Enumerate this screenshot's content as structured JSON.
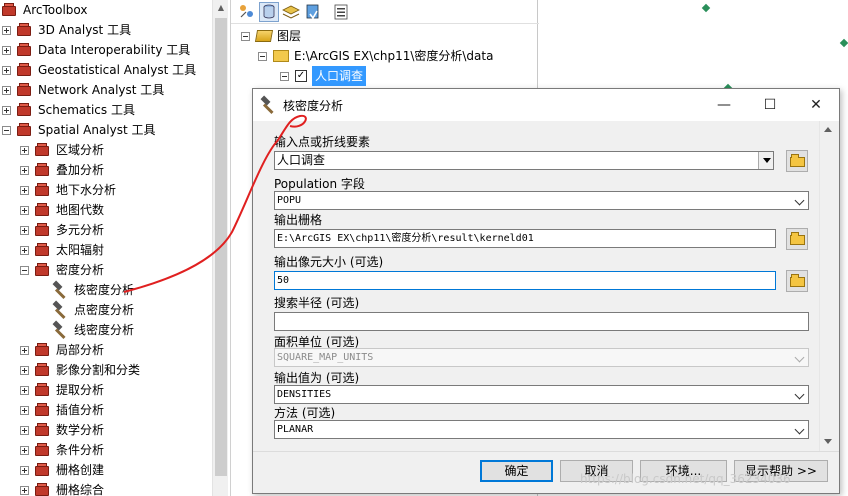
{
  "toolbox": {
    "root": "ArcToolbox",
    "toolsets": [
      {
        "label": "3D Analyst 工具",
        "expanded": false
      },
      {
        "label": "Data Interoperability 工具",
        "expanded": false
      },
      {
        "label": "Geostatistical Analyst 工具",
        "expanded": false
      },
      {
        "label": "Network Analyst 工具",
        "expanded": false
      },
      {
        "label": "Schematics 工具",
        "expanded": false
      },
      {
        "label": "Spatial Analyst 工具",
        "expanded": true
      }
    ],
    "spatial_children": [
      {
        "label": "区域分析",
        "expanded": false
      },
      {
        "label": "叠加分析",
        "expanded": false
      },
      {
        "label": "地下水分析",
        "expanded": false
      },
      {
        "label": "地图代数",
        "expanded": false
      },
      {
        "label": "多元分析",
        "expanded": false
      },
      {
        "label": "太阳辐射",
        "expanded": false
      },
      {
        "label": "密度分析",
        "expanded": true
      },
      {
        "label": "局部分析",
        "expanded": false
      },
      {
        "label": "影像分割和分类",
        "expanded": false
      },
      {
        "label": "提取分析",
        "expanded": false
      },
      {
        "label": "插值分析",
        "expanded": false
      },
      {
        "label": "数学分析",
        "expanded": false
      },
      {
        "label": "条件分析",
        "expanded": false
      },
      {
        "label": "栅格创建",
        "expanded": false
      },
      {
        "label": "栅格综合",
        "expanded": false
      }
    ],
    "density_tools": [
      {
        "label": "核密度分析"
      },
      {
        "label": "点密度分析"
      },
      {
        "label": "线密度分析"
      }
    ]
  },
  "toc": {
    "layers_label": "图层",
    "folder_path": "E:\\ArcGIS EX\\chp11\\密度分析\\data",
    "layer_name": "人口调查",
    "layer_checked": "✓"
  },
  "dialog": {
    "title": "核密度分析",
    "minimize": "—",
    "maximize": "☐",
    "close": "✕",
    "fields": {
      "input_features_label": "输入点或折线要素",
      "input_features_value": "人口调查",
      "population_label": "Population 字段",
      "population_value": "POPU",
      "output_raster_label": "输出栅格",
      "output_raster_value": "E:\\ArcGIS EX\\chp11\\密度分析\\result\\kerneld01",
      "cell_size_label": "输出像元大小 (可选)",
      "cell_size_value": "50",
      "search_radius_label": "搜索半径 (可选)",
      "search_radius_value": "",
      "area_units_label": "面积单位 (可选)",
      "area_units_value": "SQUARE_MAP_UNITS",
      "output_values_label": "输出值为 (可选)",
      "output_values_value": "DENSITIES",
      "method_label": "方法 (可选)",
      "method_value": "PLANAR"
    },
    "buttons": {
      "ok": "确定",
      "cancel": "取消",
      "environments": "环境...",
      "show_help": "显示帮助 >>"
    }
  },
  "watermark": "https://blog.csdn.net/qq_36234036",
  "colors": {
    "annotation_stroke": "#e02020",
    "selection": "#3399ff",
    "map_point": "#2a8f5a",
    "focus_border": "#0078d7"
  }
}
